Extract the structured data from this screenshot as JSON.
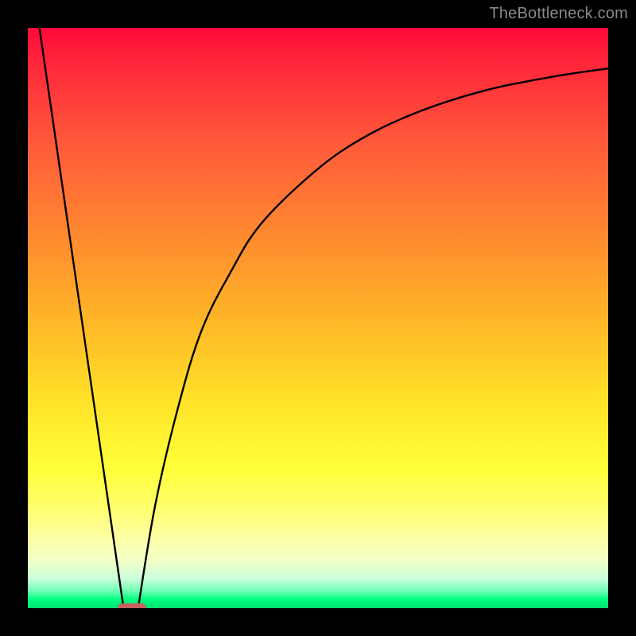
{
  "watermark_text": "TheBottleneck.com",
  "chart_data": {
    "type": "line",
    "title": "",
    "xlabel": "",
    "ylabel": "",
    "xlim": [
      0,
      100
    ],
    "ylim": [
      0,
      100
    ],
    "axes_visible": false,
    "grid": false,
    "background_gradient": {
      "direction": "vertical",
      "stops": [
        {
          "pos": 0,
          "color": "#ff0a3a"
        },
        {
          "pos": 20,
          "color": "#ff5a3a"
        },
        {
          "pos": 50,
          "color": "#ffb528"
        },
        {
          "pos": 76,
          "color": "#ffff3a"
        },
        {
          "pos": 95,
          "color": "#c8ffdc"
        },
        {
          "pos": 100,
          "color": "#00e070"
        }
      ]
    },
    "series": [
      {
        "name": "left-line",
        "x": [
          2,
          16.5
        ],
        "y": [
          100,
          0
        ]
      },
      {
        "name": "right-curve",
        "x": [
          19,
          22,
          26,
          30,
          35,
          40,
          48,
          56,
          66,
          78,
          90,
          100
        ],
        "y": [
          0,
          18,
          35,
          48,
          58,
          66,
          74,
          80,
          85,
          89,
          91.5,
          93
        ]
      }
    ],
    "optimum_marker": {
      "x": 18,
      "y": 0,
      "color": "#c86060"
    }
  }
}
